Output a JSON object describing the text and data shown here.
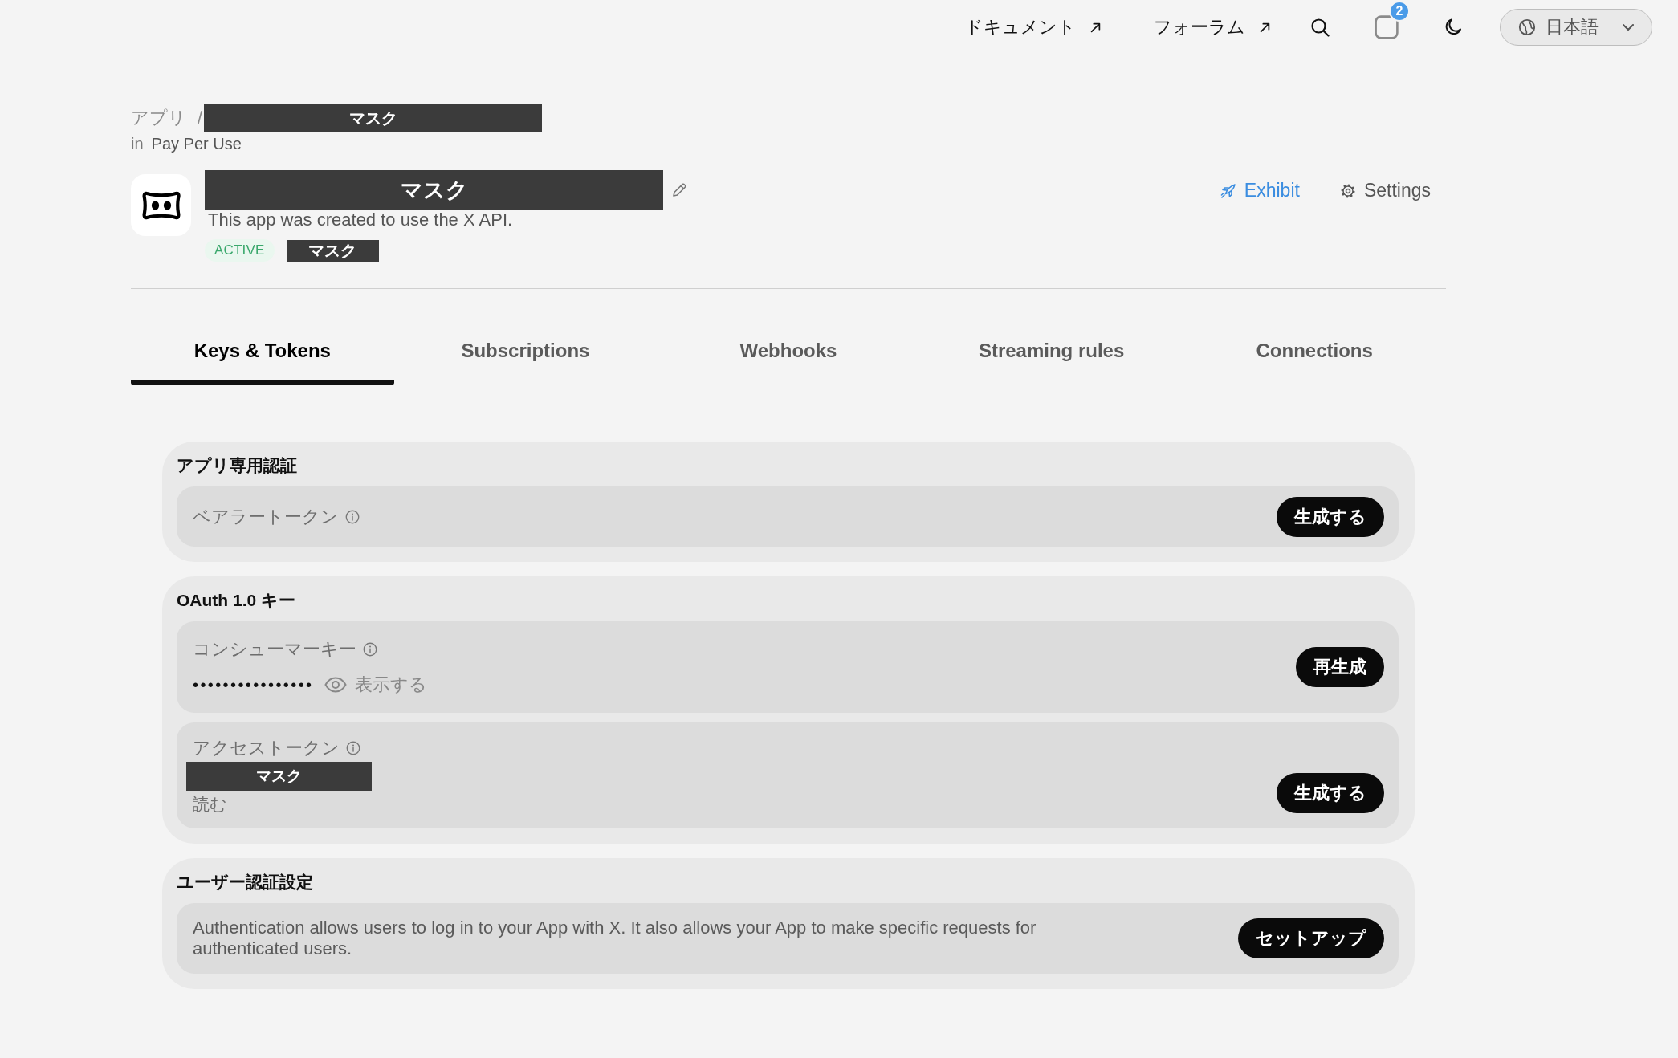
{
  "top_nav": {
    "links": [
      {
        "label": "ドキュメント"
      },
      {
        "label": "フォーラム"
      }
    ],
    "cart_count": "2",
    "language": "日本語"
  },
  "breadcrumb": {
    "parent": "アプリ",
    "separator": "/",
    "current": "マスク"
  },
  "workspace": {
    "prefix": "in",
    "name": "Pay Per Use"
  },
  "app": {
    "name": "マスク",
    "description": "This app was created to use the X API.",
    "status": "ACTIVE",
    "tag": "マスク"
  },
  "actions": [
    {
      "label": "Exhibit",
      "kind": "launch"
    },
    {
      "label": "Settings",
      "kind": "settings"
    }
  ],
  "tabs": [
    {
      "label": "Keys & Tokens",
      "selected": true
    },
    {
      "label": "Subscriptions",
      "selected": false
    },
    {
      "label": "Webhooks",
      "selected": false
    },
    {
      "label": "Streaming rules",
      "selected": false
    },
    {
      "label": "Connections",
      "selected": false
    }
  ],
  "sections": [
    {
      "title": "アプリ専用認証",
      "rows": [
        {
          "kind": "action",
          "label": "ベアラートークン",
          "button": "生成する"
        }
      ]
    },
    {
      "title": "OAuth 1.0 キー",
      "rows": [
        {
          "kind": "secret",
          "label": "コンシューマーキー",
          "value": "••••••••••••••••",
          "reveal": "表示する",
          "button": "再生成"
        },
        {
          "kind": "token",
          "label": "アクセストークン",
          "token": "マスク",
          "scope": "読む",
          "button": "生成する"
        }
      ]
    },
    {
      "title": "ユーザー認証設定",
      "rows": [
        {
          "kind": "text",
          "text": "Authentication allows users to log in to your App with X. It also allows your App to make specific requests for authenticated users.",
          "button": "セットアップ"
        }
      ]
    }
  ]
}
